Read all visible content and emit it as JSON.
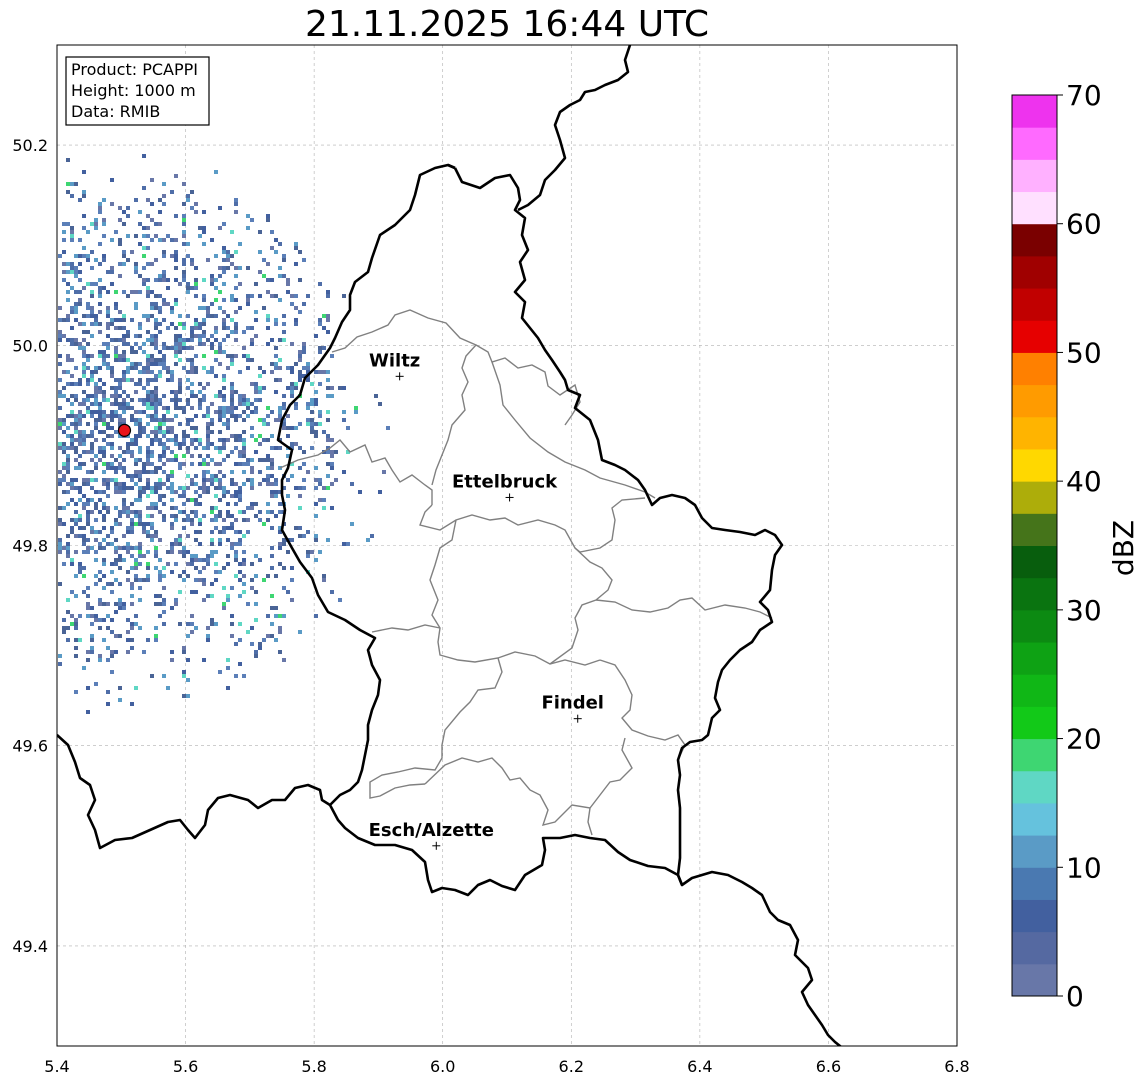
{
  "title": "21.11.2025 16:44 UTC",
  "info_box": {
    "product": "Product: PCAPPI",
    "height": "Height: 1000 m",
    "data_source": "Data: RMIB"
  },
  "map": {
    "xlim": [
      5.4,
      6.8
    ],
    "ylim": [
      49.3,
      50.3
    ],
    "x_ticks": [
      "5.4",
      "5.6",
      "5.8",
      "6.0",
      "6.2",
      "6.4",
      "6.6",
      "6.8"
    ],
    "y_ticks": [
      "49.4",
      "49.6",
      "49.8",
      "50.0",
      "50.2"
    ],
    "grid": true,
    "radar_site": {
      "lon": 5.505,
      "lat": 49.915,
      "color": "#e8141a"
    },
    "cities": [
      {
        "name": "Wiltz",
        "lon": 5.933,
        "lat": 49.969
      },
      {
        "name": "Ettelbruck",
        "lon": 6.104,
        "lat": 49.848
      },
      {
        "name": "Findel",
        "lon": 6.21,
        "lat": 49.627
      },
      {
        "name": "Esch/Alzette",
        "lon": 5.99,
        "lat": 49.5
      }
    ],
    "border_color": "#000000",
    "canton_color": "#808080"
  },
  "colorbar": {
    "label": "dBZ",
    "ticks": [
      "0",
      "10",
      "20",
      "30",
      "40",
      "50",
      "60",
      "70"
    ],
    "range": [
      0,
      70
    ],
    "step": 2.5,
    "colors": [
      "#6877a8",
      "#5569a1",
      "#42609f",
      "#4a79b1",
      "#5a9bc6",
      "#65c2dd",
      "#5fd7c4",
      "#3ed672",
      "#12c918",
      "#10b716",
      "#0ea214",
      "#0c8a12",
      "#0a7410",
      "#085e0d",
      "#45741a",
      "#adad0a",
      "#ffd800",
      "#ffb400",
      "#ff9b00",
      "#ff8000",
      "#e60000",
      "#c10000",
      "#a00000",
      "#7a0000",
      "#ffe0ff",
      "#ffb1ff",
      "#ff6aff",
      "#ee33ee"
    ]
  }
}
